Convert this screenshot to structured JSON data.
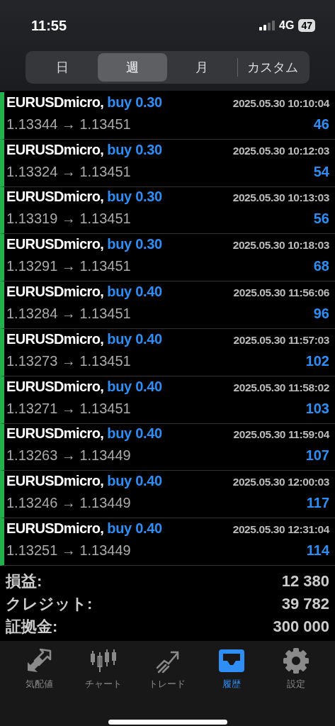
{
  "status_bar": {
    "time": "11:55",
    "network": "4G",
    "battery": "47"
  },
  "tabs": [
    {
      "label": "日",
      "selected": false
    },
    {
      "label": "週",
      "selected": true
    },
    {
      "label": "月",
      "selected": false
    },
    {
      "label": "カスタム",
      "selected": false
    }
  ],
  "deals": [
    {
      "symbol": "EURUSDmicro,",
      "order": "buy 0.30",
      "time": "2025.05.30 10:10:04",
      "prices": "1.13344 → 1.13451",
      "profit": "46"
    },
    {
      "symbol": "EURUSDmicro,",
      "order": "buy 0.30",
      "time": "2025.05.30 10:12:03",
      "prices": "1.13324 → 1.13451",
      "profit": "54"
    },
    {
      "symbol": "EURUSDmicro,",
      "order": "buy 0.30",
      "time": "2025.05.30 10:13:03",
      "prices": "1.13319 → 1.13451",
      "profit": "56"
    },
    {
      "symbol": "EURUSDmicro,",
      "order": "buy 0.30",
      "time": "2025.05.30 10:18:03",
      "prices": "1.13291 → 1.13451",
      "profit": "68"
    },
    {
      "symbol": "EURUSDmicro,",
      "order": "buy 0.40",
      "time": "2025.05.30 11:56:06",
      "prices": "1.13284 → 1.13451",
      "profit": "96"
    },
    {
      "symbol": "EURUSDmicro,",
      "order": "buy 0.40",
      "time": "2025.05.30 11:57:03",
      "prices": "1.13273 → 1.13451",
      "profit": "102"
    },
    {
      "symbol": "EURUSDmicro,",
      "order": "buy 0.40",
      "time": "2025.05.30 11:58:02",
      "prices": "1.13271 → 1.13451",
      "profit": "103"
    },
    {
      "symbol": "EURUSDmicro,",
      "order": "buy 0.40",
      "time": "2025.05.30 11:59:04",
      "prices": "1.13263 → 1.13449",
      "profit": "107"
    },
    {
      "symbol": "EURUSDmicro,",
      "order": "buy 0.40",
      "time": "2025.05.30 12:00:03",
      "prices": "1.13246 → 1.13449",
      "profit": "117"
    },
    {
      "symbol": "EURUSDmicro,",
      "order": "buy 0.40",
      "time": "2025.05.30 12:31:04",
      "prices": "1.13251 → 1.13449",
      "profit": "114"
    }
  ],
  "summary": [
    {
      "label": "損益:",
      "value": "12 380"
    },
    {
      "label": "クレジット:",
      "value": "39 782"
    },
    {
      "label": "証拠金:",
      "value": "300 000"
    }
  ],
  "nav": [
    {
      "kind": "quotes",
      "label": "気配値",
      "selected": false
    },
    {
      "kind": "chart",
      "label": "チャート",
      "selected": false
    },
    {
      "kind": "trade",
      "label": "トレード",
      "selected": false
    },
    {
      "kind": "history",
      "label": "履歴",
      "selected": true
    },
    {
      "kind": "settings",
      "label": "設定",
      "selected": false
    }
  ]
}
